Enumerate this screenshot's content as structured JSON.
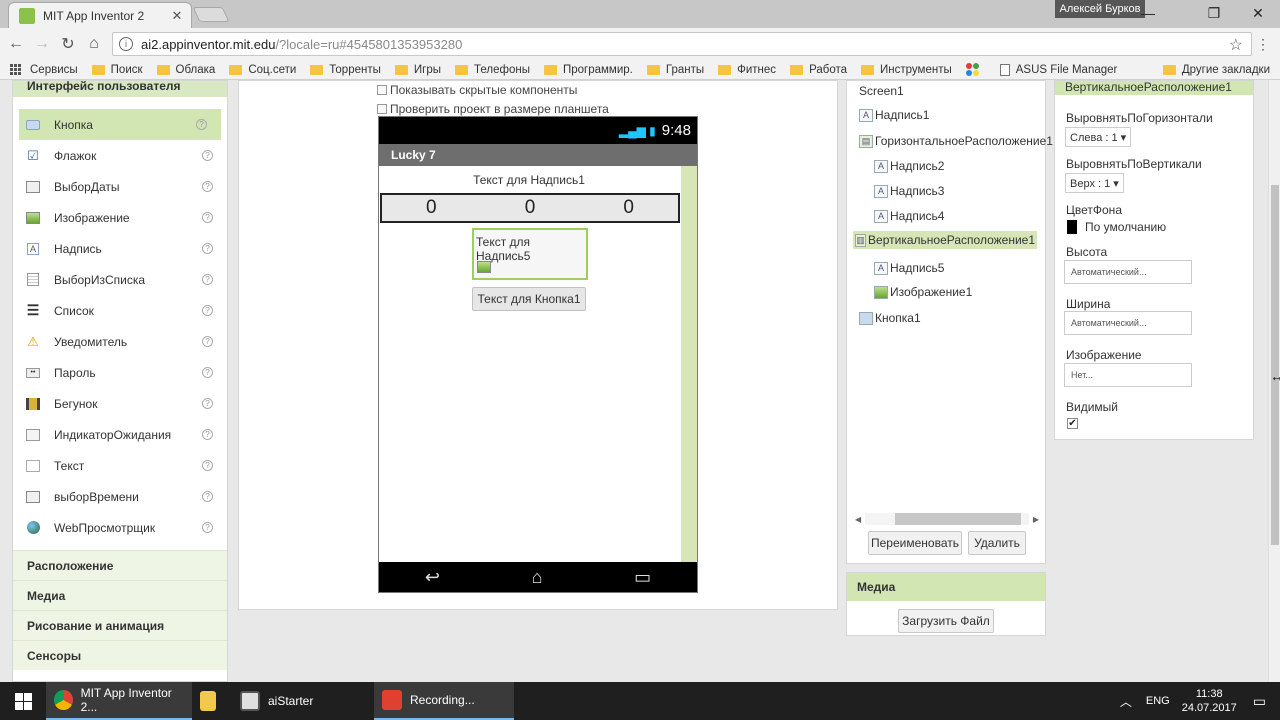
{
  "browser": {
    "tab_title": "MIT App Inventor 2",
    "tab_close": "✕",
    "user_name": "Алексей Бурков",
    "url_host": "ai2.appinventor.mit.edu",
    "url_rest": "/?locale=ru#4545801353953280",
    "bookmarks": [
      "Сервисы",
      "Поиск",
      "Облака",
      "Соц.сети",
      "Торренты",
      "Игры",
      "Телефоны",
      "Программир.",
      "Гранты",
      "Фитнес",
      "Работа",
      "Инструменты",
      "ASUS File Manager"
    ],
    "other_bookmarks": "Другие закладки"
  },
  "palette": {
    "header": "Интерфейс пользователя",
    "items": [
      {
        "label": "Кнопка",
        "icon": "button-icon"
      },
      {
        "label": "Флажок",
        "icon": "checkbox-icon"
      },
      {
        "label": "ВыборДаты",
        "icon": "datepicker-icon"
      },
      {
        "label": "Изображение",
        "icon": "image-icon"
      },
      {
        "label": "Надпись",
        "icon": "label-icon"
      },
      {
        "label": "ВыборИзСписка",
        "icon": "listpicker-icon"
      },
      {
        "label": "Список",
        "icon": "listview-icon"
      },
      {
        "label": "Уведомитель",
        "icon": "notifier-icon"
      },
      {
        "label": "Пароль",
        "icon": "password-icon"
      },
      {
        "label": "Бегунок",
        "icon": "slider-icon"
      },
      {
        "label": "ИндикаторОжидания",
        "icon": "spinner-icon"
      },
      {
        "label": "Текст",
        "icon": "textbox-icon"
      },
      {
        "label": "выборВремени",
        "icon": "timepicker-icon"
      },
      {
        "label": "WebПросмотрщик",
        "icon": "webviewer-icon"
      }
    ],
    "help": "?",
    "groups": [
      "Расположение",
      "Медиа",
      "Рисование и анимация",
      "Сенсоры"
    ]
  },
  "viewer": {
    "show_hidden": "Показывать скрытые компоненты",
    "tablet_preview": "Проверить проект в размере планшета",
    "phone_time": "9:48",
    "screen_title": "Lucky 7",
    "label1": "Текст для Надпись1",
    "numbers": [
      "0",
      "0",
      "0"
    ],
    "label5": "Текст для Надпись5",
    "button1": "Текст для Кнопка1"
  },
  "components": {
    "tree": [
      {
        "label": "Screen1",
        "level": 0
      },
      {
        "label": "Надпись1",
        "level": 1
      },
      {
        "label": "ГоризонтальноеРасположение1",
        "level": 1
      },
      {
        "label": "Надпись2",
        "level": 2
      },
      {
        "label": "Надпись3",
        "level": 2
      },
      {
        "label": "Надпись4",
        "level": 2
      },
      {
        "label": "ВертикальноеРасположение1",
        "level": 1,
        "selected": true
      },
      {
        "label": "Надпись5",
        "level": 2
      },
      {
        "label": "Изображение1",
        "level": 2
      },
      {
        "label": "Кнопка1",
        "level": 1
      }
    ],
    "rename_button": "Переименовать",
    "delete_button": "Удалить"
  },
  "media": {
    "header": "Медиа",
    "upload_button": "Загрузить Файл"
  },
  "properties": {
    "header": "ВертикальноеРасположение1",
    "align_h_label": "ВыровнятьПоГоризонтали",
    "align_h_value": "Слева : 1 ▾",
    "align_v_label": "ВыровнятьПоВертикали",
    "align_v_value": "Верх : 1 ▾",
    "bg_label": "ЦветФона",
    "bg_value": "По умолчанию",
    "height_label": "Высота",
    "height_value": "Автоматический...",
    "width_label": "Ширина",
    "width_value": "Автоматический...",
    "image_label": "Изображение",
    "image_value": "Нет...",
    "visible_label": "Видимый",
    "visible_checked": true
  },
  "taskbar": {
    "tasks": [
      "MIT App Inventor 2...",
      "aiStarter",
      "Recording..."
    ],
    "lang": "ENG",
    "time": "11:38",
    "date": "24.07.2017"
  },
  "colors": {
    "accent_green": "#d2e6b4",
    "selection_border": "#9ecf5a",
    "taskbar": "#1f1f1f"
  }
}
